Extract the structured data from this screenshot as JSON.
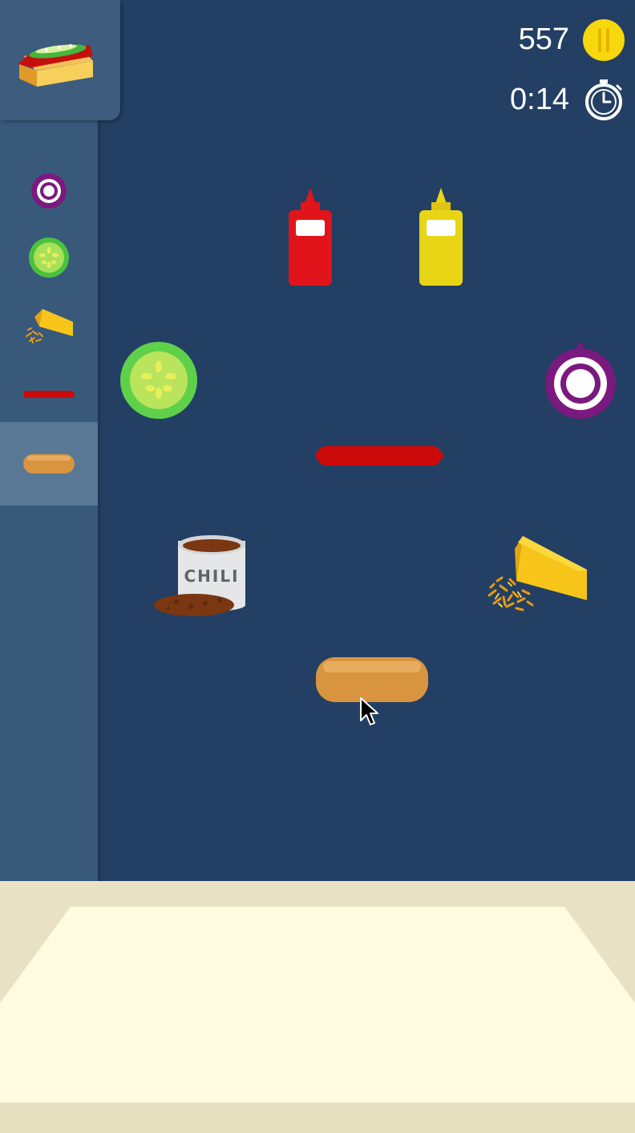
{
  "hud": {
    "coins": "557",
    "coin_icon": "coin-icon",
    "timer": "0:14",
    "timer_icon": "stopwatch-icon"
  },
  "order": {
    "icon": "hotdog-order-icon"
  },
  "sidebar": {
    "items": [
      {
        "name": "red-onion",
        "icon": "onion-icon",
        "selected": false
      },
      {
        "name": "cucumber",
        "icon": "cucumber-icon",
        "selected": false
      },
      {
        "name": "cheese",
        "icon": "cheese-icon",
        "selected": false
      },
      {
        "name": "sausage",
        "icon": "sausage-icon",
        "selected": false
      },
      {
        "name": "bun",
        "icon": "bun-icon",
        "selected": true
      }
    ]
  },
  "ingredients": {
    "ketchup": {
      "icon": "ketchup-bottle-icon",
      "color": "#e0141a"
    },
    "mustard": {
      "icon": "mustard-bottle-icon",
      "color": "#e8d616"
    },
    "cucumber": {
      "icon": "cucumber-slice-icon",
      "color": "#5fd04a"
    },
    "onion": {
      "icon": "red-onion-icon",
      "color": "#7a1a7e"
    },
    "sausage": {
      "icon": "sausage-icon",
      "color": "#cc0a0a"
    },
    "chili": {
      "icon": "chili-can-icon",
      "label": "CHILI"
    },
    "cheese": {
      "icon": "cheese-wedge-icon",
      "color": "#f7c51a"
    },
    "bun": {
      "icon": "bun-icon",
      "color": "#d99440"
    }
  },
  "cursor": {
    "icon": "mouse-pointer-icon"
  },
  "counter": {
    "color": "#fffbe0"
  }
}
